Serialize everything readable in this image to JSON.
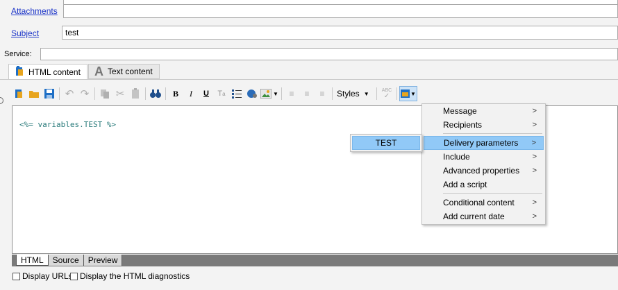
{
  "form": {
    "attachments_label": "Attachments",
    "attachments_value": "",
    "subject_label": "Subject",
    "subject_value": "test",
    "service_label": "Service:",
    "service_value": ""
  },
  "tabs": [
    {
      "label": "HTML content",
      "icon": "html-content-icon",
      "active": true
    },
    {
      "label": "Text content",
      "icon": "text-a-icon",
      "active": false
    }
  ],
  "toolbar": {
    "styles_label": "Styles",
    "icons": [
      "personalize-icon",
      "open-folder-icon",
      "save-icon",
      "undo-icon",
      "redo-icon",
      "copy-icon",
      "cut-icon",
      "paste-icon",
      "find-icon",
      "bold-icon",
      "italic-icon",
      "underline-icon",
      "clear-format-icon",
      "list-icon",
      "link-icon",
      "image-icon",
      "align-left-icon",
      "align-center-icon",
      "align-right-icon",
      "spellcheck-icon",
      "insert-field-icon"
    ]
  },
  "editor": {
    "code": "<%= variables.TEST %>"
  },
  "bottom_tabs": [
    "HTML",
    "Source",
    "Preview"
  ],
  "checkboxes": [
    {
      "label": "Display URLs",
      "checked": false
    },
    {
      "label": "Display the HTML diagnostics",
      "checked": false
    }
  ],
  "context_menu": {
    "items": [
      {
        "label": "Message",
        "submenu": true
      },
      {
        "label": "Recipients",
        "submenu": true
      },
      {
        "label": "Delivery parameters",
        "submenu": true,
        "highlighted": true
      },
      {
        "label": "Include",
        "submenu": true
      },
      {
        "label": "Advanced properties",
        "submenu": true
      },
      {
        "label": "Add a script",
        "submenu": false
      },
      {
        "label": "Conditional content",
        "submenu": true
      },
      {
        "label": "Add current date",
        "submenu": true
      }
    ],
    "arrow": ">"
  },
  "submenu": {
    "items": [
      {
        "label": "TEST",
        "highlighted": true
      }
    ]
  },
  "colors": {
    "link": "#1a33c8",
    "highlight": "#91c9f7",
    "code_text": "#2a7b7b",
    "toolbar_blue": "#1f6fc5",
    "toolbar_orange": "#e8a51e"
  }
}
